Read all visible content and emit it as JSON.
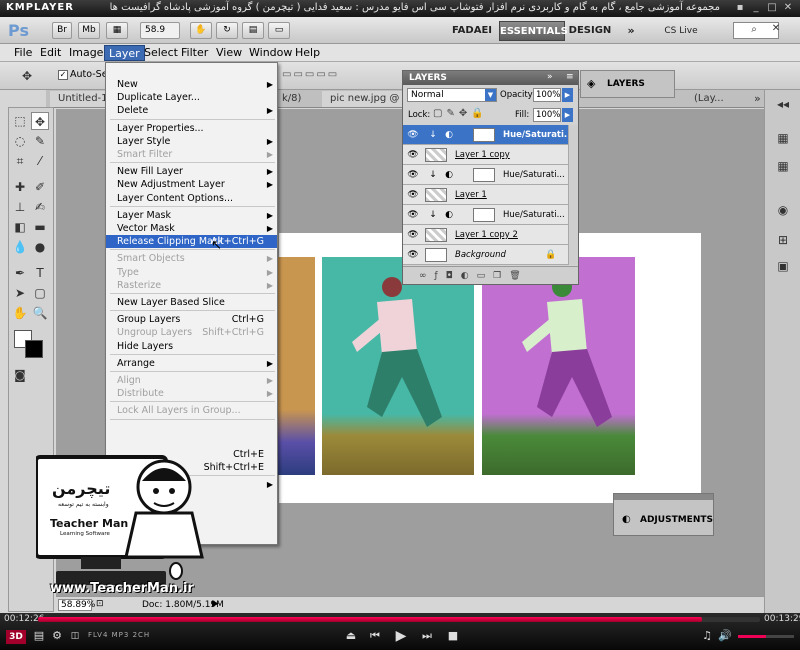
{
  "kmplayer": {
    "logo": "KMPLAYER",
    "title": "مجموعه آموزشی جامع ، گام به گام و کاربردی نرم افزار فتوشاپ سی اس فایو  مدرس : سعید فدایی ( تیچرمن ) گروه آموزشی پادشاه گرافیست ها",
    "time_elapsed": "00:12:26",
    "time_total": "00:13:29",
    "progress_fraction": 0.92,
    "badges": [
      "FLV4",
      "MP3",
      "2CH"
    ]
  },
  "photoshop": {
    "logo": "Ps",
    "bridge_btn": "Br",
    "mini_bridge_btn": "Mb",
    "zoom_select": "58.9",
    "workspaces": [
      "FADAEI",
      "ESSENTIALS",
      "DESIGN"
    ],
    "cs_live": "CS Live",
    "menus": [
      "File",
      "Edit",
      "Image",
      "Layer",
      "Select",
      "Filter",
      "View",
      "Window",
      "Help"
    ],
    "options_checkbox": "Auto-Select",
    "tabs": [
      "Untitled-1",
      "k/8)",
      "pic new.jpg @ 58",
      "(Lay..."
    ],
    "status_zoom": "58.89%",
    "status_doc": "Doc: 1.80M/5.19M"
  },
  "layer_menu": [
    {
      "label": "New",
      "arrow": true
    },
    {
      "label": "Duplicate Layer..."
    },
    {
      "label": "Delete",
      "arrow": true
    },
    {
      "sep": true
    },
    {
      "label": "Layer Properties..."
    },
    {
      "label": "Layer Style",
      "arrow": true
    },
    {
      "label": "Smart Filter",
      "disabled": true,
      "arrow": true
    },
    {
      "sep": true
    },
    {
      "label": "New Fill Layer",
      "arrow": true
    },
    {
      "label": "New Adjustment Layer",
      "arrow": true
    },
    {
      "label": "Layer Content Options..."
    },
    {
      "sep": true
    },
    {
      "label": "Layer Mask",
      "arrow": true
    },
    {
      "label": "Vector Mask",
      "arrow": true
    },
    {
      "label": "Release Clipping Mask",
      "shortcut": "Alt+Ctrl+G",
      "highlight": true
    },
    {
      "sep": true
    },
    {
      "label": "Smart Objects",
      "disabled": true,
      "arrow": true
    },
    {
      "label": "Type",
      "disabled": true,
      "arrow": true
    },
    {
      "label": "Rasterize",
      "disabled": true,
      "arrow": true
    },
    {
      "sep": true
    },
    {
      "label": "New Layer Based Slice"
    },
    {
      "sep": true
    },
    {
      "label": "Group Layers",
      "shortcut": "Ctrl+G"
    },
    {
      "label": "Ungroup Layers",
      "shortcut": "Shift+Ctrl+G",
      "disabled": true
    },
    {
      "label": "Hide Layers"
    },
    {
      "sep": true
    },
    {
      "label": "Arrange",
      "arrow": true
    },
    {
      "sep": true
    },
    {
      "label": "Align",
      "disabled": true,
      "arrow": true
    },
    {
      "label": "Distribute",
      "disabled": true,
      "arrow": true
    },
    {
      "sep": true
    },
    {
      "label": "Lock All Layers in Group...",
      "disabled": true
    },
    {
      "sep": true
    },
    {
      "label": "",
      "disabled": true
    },
    {
      "label": "",
      "disabled": true
    },
    {
      "label": "",
      "shortcut": "Ctrl+E"
    },
    {
      "label": "",
      "shortcut": "Shift+Ctrl+E"
    },
    {
      "sep": true
    },
    {
      "label": "",
      "arrow": true
    }
  ],
  "layers_panel": {
    "title": "LAYERS",
    "blend_mode": "Normal",
    "opacity_label": "Opacity:",
    "opacity": "100%",
    "lock_label": "Lock:",
    "fill_label": "Fill:",
    "fill": "100%",
    "layers": [
      {
        "name": "Hue/Saturati...",
        "adjust": true,
        "clipped": true,
        "selected": true
      },
      {
        "name": "Layer 1 copy",
        "adjust": false
      },
      {
        "name": "Hue/Saturati...",
        "adjust": true,
        "clipped": true
      },
      {
        "name": "Layer 1",
        "adjust": false
      },
      {
        "name": "Hue/Saturati...",
        "adjust": true,
        "clipped": true
      },
      {
        "name": "Layer 1 copy 2",
        "adjust": false
      },
      {
        "name": "Background",
        "adjust": false,
        "italic": true,
        "locked": true
      }
    ]
  },
  "dock_panel": {
    "layers_label": "LAYERS",
    "adjustments_label": "ADJUSTMENTS"
  },
  "teacher": {
    "brand_fa": "تیچرمن",
    "subtitle_fa": "وابسته به تیم توسعه",
    "brand_en": "Teacher Man",
    "sub_en": "Learning Software",
    "website": "www.TeacherMan.ir"
  },
  "colors": {
    "accent": "#2e65c6",
    "photo1": "#c9964f",
    "photo2": "#47b8a6",
    "photo3": "#c16fd1"
  }
}
